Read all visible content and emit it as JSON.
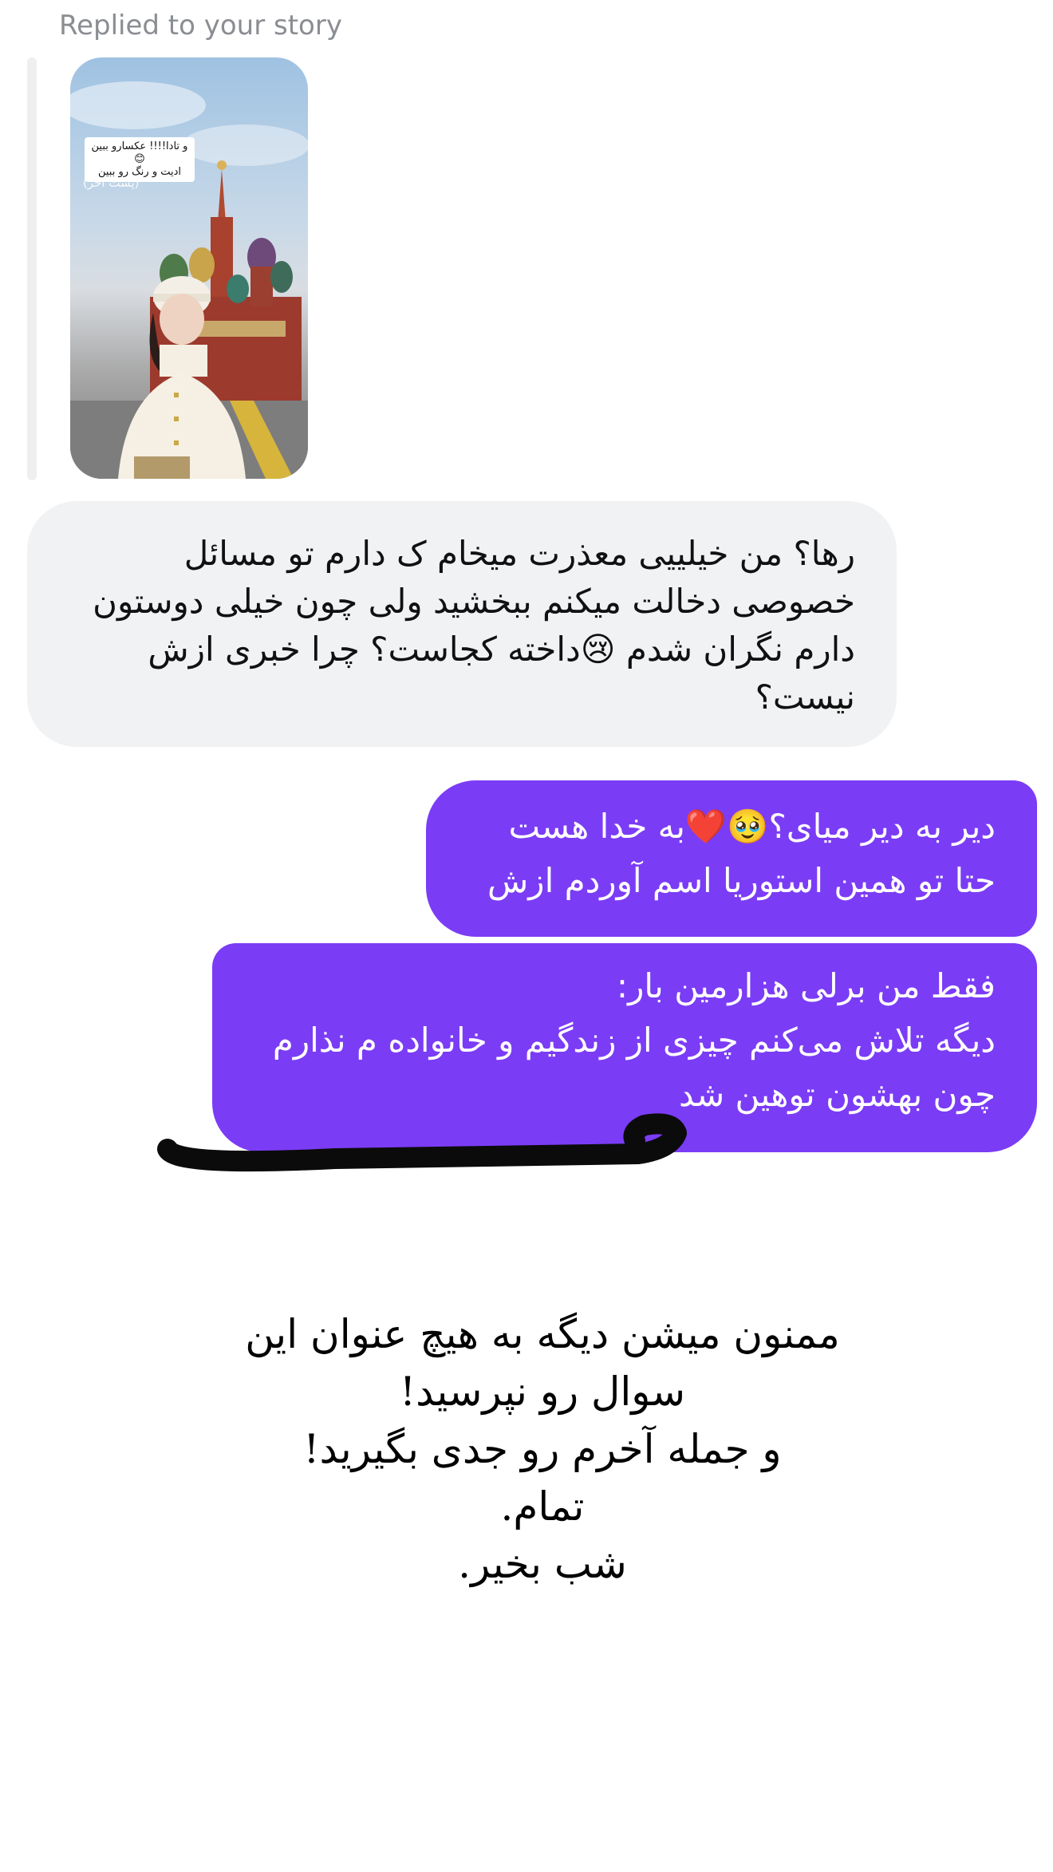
{
  "reply": {
    "label": "Replied to your story"
  },
  "story": {
    "sticker_text": "و تادا!!!! عکسارو ببین😊\nادیت و رنگ رو ببین",
    "caption": "(پست اخر)"
  },
  "messages": {
    "incoming": "رها؟ من خیلییی معذرت میخام ک دارم تو مسائل خصوصی دخالت میکنم ببخشید ولی چون خیلی دوستون دارم نگران شدم 😢داخته کجاست؟ چرا خبری ازش نیست؟",
    "outgoing_1": "دیر به دیر میای؟🥹❤️به خدا هست\nحتا تو همین استوریا اسم آوردم ازش",
    "outgoing_2": "فقط من برلی هزارمین بار:\nدیگه تلاش می‌کنم چیزی از زندگیم و خانواده م نذارم\nچون بهشون توهین شد"
  },
  "overlay_caption": "ممنون میشن دیگه به هیچ عنوان این\nسوال رو نپرسید!\nو جمله آخرم رو جدی بگیرید!\nتمام.\nشب بخیر.",
  "colors": {
    "outgoing_bubble": "#7b3cf6",
    "incoming_bubble": "#f1f2f4",
    "label_gray": "#8a8d91"
  }
}
